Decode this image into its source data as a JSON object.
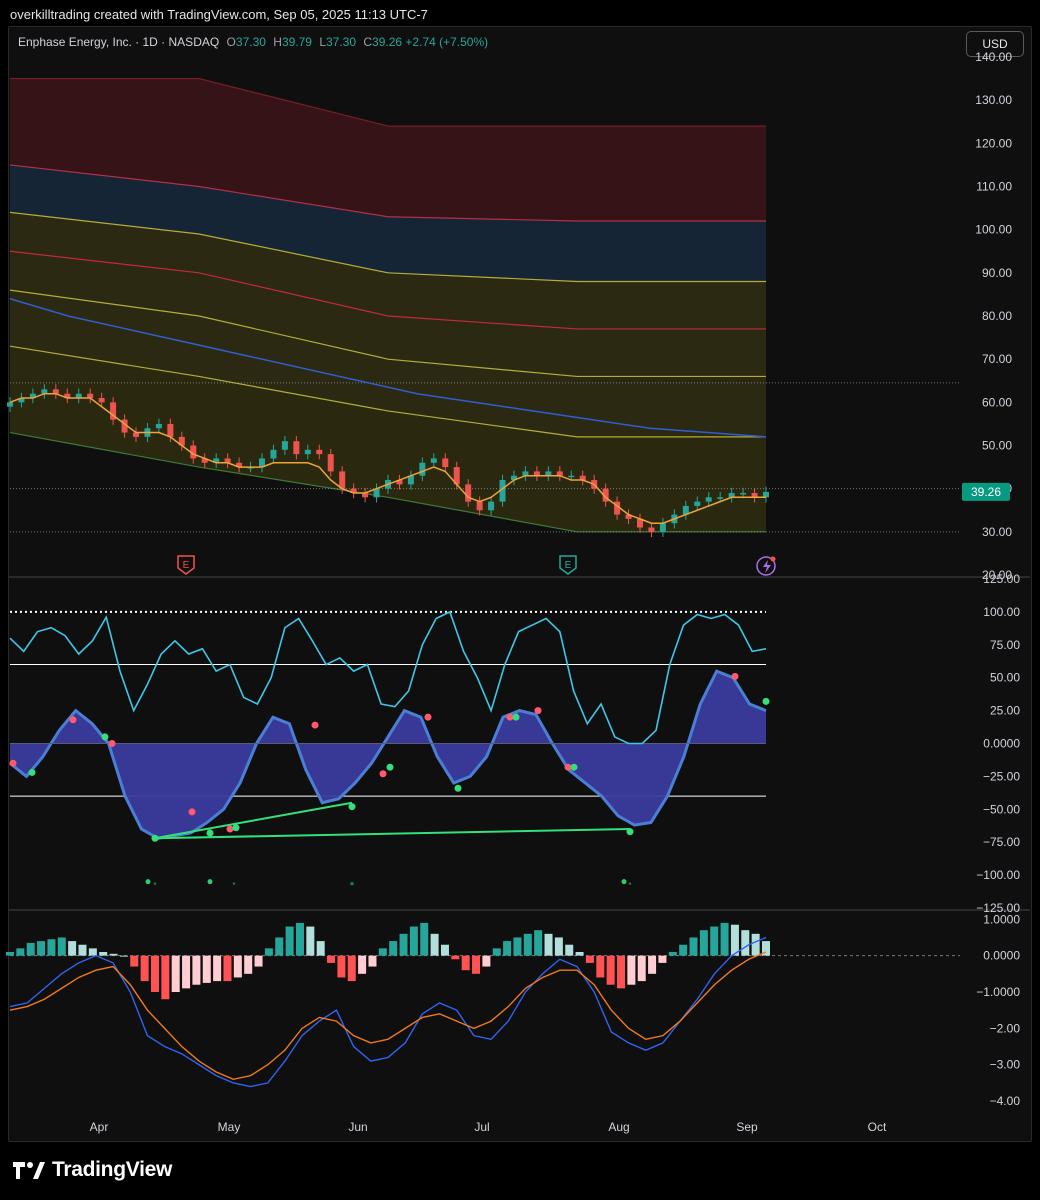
{
  "header": {
    "attribution": "overkilltrading created with TradingView.com, Sep 05, 2025 11:13 UTC-7",
    "symbol": "Enphase Energy, Inc. · 1D · NASDAQ",
    "o_label": "O",
    "o_value": "37.30",
    "h_label": "H",
    "h_value": "39.79",
    "l_label": "L",
    "l_value": "37.30",
    "c_label": "C",
    "c_value": "39.26",
    "change": "+2.74 (+7.50%)"
  },
  "currency_button": "USD",
  "brand": {
    "name": "TradingView"
  },
  "chart_data": [
    {
      "type": "candlestick",
      "panel": "price",
      "x_ticks": [
        "Apr",
        "May",
        "Jun",
        "Jul",
        "Aug",
        "Sep",
        "Oct"
      ],
      "y_ticks": [
        "140.00",
        "130.00",
        "120.00",
        "110.00",
        "100.00",
        "90.00",
        "80.00",
        "70.00",
        "60.00",
        "50.00",
        "40.00",
        "30.00",
        "20.00"
      ],
      "ylim": [
        20,
        140
      ],
      "last_price_label": "39.26",
      "last_price": 39.26,
      "horizontal_levels": [
        64.5,
        40,
        30
      ],
      "earnings_markers": [
        "E",
        "E"
      ],
      "close_path": [
        60,
        61,
        62,
        63,
        62,
        61,
        62,
        61,
        60,
        56,
        53,
        52,
        54,
        55,
        52,
        50,
        47,
        46,
        47,
        46,
        45,
        45,
        47,
        49,
        51,
        48,
        49,
        48,
        44,
        40,
        39,
        38,
        40,
        42,
        41,
        43,
        46,
        47,
        45,
        41,
        37,
        35,
        37,
        42,
        43,
        44,
        43,
        44,
        43,
        43,
        42,
        40,
        37,
        34,
        33,
        31,
        30,
        32,
        34,
        36,
        37,
        38,
        38,
        39,
        39,
        38,
        39.26
      ],
      "ma_fast": [
        60,
        61,
        61,
        62,
        62,
        61,
        61,
        61,
        59,
        57,
        55,
        53,
        53,
        53,
        52,
        50,
        48,
        47,
        46,
        46,
        45,
        45,
        45,
        46,
        46,
        46,
        46,
        45,
        42,
        40,
        39,
        39,
        40,
        41,
        42,
        43,
        44,
        45,
        44,
        41,
        38,
        37,
        38,
        40,
        42,
        43,
        43,
        43,
        43,
        42,
        42,
        41,
        38,
        36,
        34,
        33,
        32,
        32,
        33,
        34,
        35,
        36,
        37,
        38,
        38,
        38,
        38
      ],
      "ma_slow": [
        84,
        80,
        77,
        74,
        71,
        68,
        65,
        62,
        60,
        58,
        56,
        54,
        53,
        52
      ],
      "band_levels_top_to_bottom": [
        {
          "name": "",
          "color": "#7b1e2b",
          "values": [
            135,
            135,
            124,
            124,
            124
          ]
        },
        {
          "name": "",
          "color": "#b3304a",
          "values": [
            115,
            110,
            103,
            102,
            102
          ]
        },
        {
          "name": "",
          "color": "#b5ad3a",
          "values": [
            104,
            99,
            90,
            88,
            88
          ]
        },
        {
          "name": "",
          "color": "#c52a3a",
          "values": [
            95,
            90,
            80,
            77,
            77
          ]
        },
        {
          "name": "",
          "color": "#b5ad3a",
          "values": [
            86,
            80,
            70,
            66,
            66
          ]
        },
        {
          "name": "",
          "color": "#b5ad3a",
          "values": [
            73,
            66,
            58,
            52,
            52
          ]
        },
        {
          "name": "",
          "color": "#3f7a3a",
          "values": [
            53,
            45,
            38,
            30,
            30
          ]
        }
      ]
    },
    {
      "type": "line",
      "panel": "oscillator",
      "y_ticks": [
        "125.00",
        "100.00",
        "75.00",
        "50.00",
        "25.00",
        "0.0000",
        "−25.00",
        "−50.00",
        "−75.00",
        "−100.00",
        "−125.00"
      ],
      "ylim": [
        -125,
        125
      ],
      "reference_lines": [
        100,
        60,
        -40
      ],
      "series": [
        {
          "name": "",
          "color": "#3ec7e8",
          "values": [
            80,
            70,
            85,
            88,
            82,
            68,
            78,
            96,
            55,
            25,
            45,
            68,
            78,
            68,
            72,
            55,
            60,
            35,
            30,
            50,
            88,
            95,
            78,
            60,
            65,
            55,
            60,
            30,
            28,
            40,
            75,
            95,
            100,
            70,
            50,
            25,
            60,
            85,
            90,
            95,
            85,
            40,
            15,
            30,
            5,
            0,
            0,
            10,
            60,
            90,
            98,
            95,
            98,
            90,
            70,
            72
          ]
        },
        {
          "name": "",
          "color": "#3b3b9e",
          "values": [
            -15,
            -25,
            -10,
            10,
            25,
            15,
            0,
            -40,
            -65,
            -72,
            -70,
            -68,
            -60,
            -50,
            -30,
            0,
            20,
            15,
            -20,
            -45,
            -42,
            -30,
            -15,
            5,
            25,
            20,
            -10,
            -30,
            -25,
            -10,
            20,
            25,
            22,
            0,
            -20,
            -30,
            -40,
            -55,
            -62,
            -60,
            -40,
            -10,
            30,
            55,
            50,
            30,
            25
          ]
        }
      ],
      "divergence_points": [
        -72,
        -68,
        -62,
        -45,
        -65
      ],
      "scatter_rows": [
        -105
      ]
    },
    {
      "type": "bar",
      "panel": "macd",
      "y_ticks": [
        "1.0000",
        "0.0000",
        "−1.0000",
        "−2.00",
        "−3.00",
        "−4.00"
      ],
      "ylim": [
        -4.3,
        1.2
      ],
      "histogram": [
        0.1,
        0.2,
        0.35,
        0.4,
        0.45,
        0.5,
        0.4,
        0.3,
        0.2,
        0.1,
        0.05,
        0.0,
        -0.3,
        -0.7,
        -1.0,
        -1.2,
        -1.0,
        -0.9,
        -0.8,
        -0.75,
        -0.7,
        -0.7,
        -0.6,
        -0.5,
        -0.3,
        0.2,
        0.5,
        0.8,
        0.9,
        0.8,
        0.4,
        -0.2,
        -0.6,
        -0.7,
        -0.5,
        -0.3,
        0.2,
        0.4,
        0.6,
        0.8,
        0.9,
        0.6,
        0.3,
        -0.1,
        -0.4,
        -0.5,
        -0.3,
        0.2,
        0.4,
        0.5,
        0.6,
        0.7,
        0.6,
        0.5,
        0.3,
        0.1,
        -0.2,
        -0.6,
        -0.8,
        -0.9,
        -0.8,
        -0.7,
        -0.5,
        -0.2,
        0.1,
        0.3,
        0.5,
        0.7,
        0.8,
        0.9,
        0.85,
        0.7,
        0.6,
        0.4
      ],
      "series": [
        {
          "name": "",
          "color": "#2f64f0",
          "values": [
            -1.4,
            -1.3,
            -0.9,
            -0.5,
            -0.2,
            0.0,
            -0.2,
            -1.0,
            -2.2,
            -2.5,
            -2.7,
            -3.0,
            -3.3,
            -3.5,
            -3.6,
            -3.5,
            -2.9,
            -2.2,
            -1.8,
            -1.5,
            -2.5,
            -2.9,
            -2.8,
            -2.4,
            -1.6,
            -1.3,
            -1.5,
            -2.2,
            -2.3,
            -1.8,
            -1.0,
            -0.5,
            -0.1,
            -0.3,
            -1.0,
            -2.1,
            -2.4,
            -2.6,
            -2.4,
            -1.8,
            -1.2,
            -0.5,
            0.0,
            0.3,
            0.5
          ]
        },
        {
          "name": "",
          "color": "#f07a1e",
          "values": [
            -1.5,
            -1.4,
            -1.2,
            -0.9,
            -0.6,
            -0.4,
            -0.3,
            -0.8,
            -1.5,
            -2.0,
            -2.5,
            -2.9,
            -3.2,
            -3.4,
            -3.3,
            -3.0,
            -2.6,
            -2.0,
            -1.7,
            -1.8,
            -2.2,
            -2.4,
            -2.3,
            -2.0,
            -1.7,
            -1.6,
            -1.8,
            -2.0,
            -1.8,
            -1.4,
            -0.9,
            -0.6,
            -0.4,
            -0.4,
            -0.8,
            -1.5,
            -2.0,
            -2.3,
            -2.2,
            -1.8,
            -1.3,
            -0.8,
            -0.4,
            -0.1,
            0.1
          ]
        }
      ]
    }
  ]
}
